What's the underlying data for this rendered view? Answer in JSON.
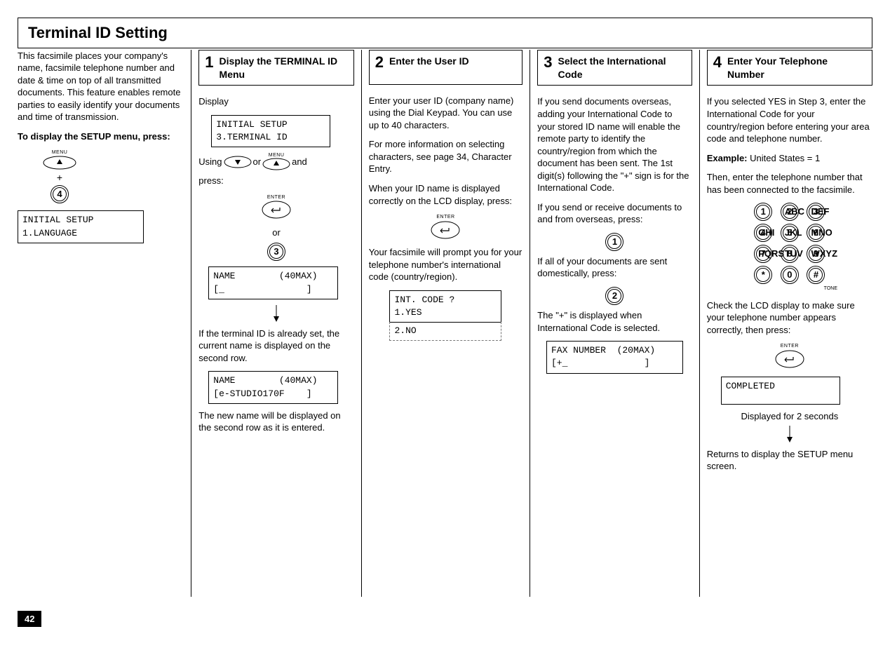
{
  "page_number": "42",
  "title": "Terminal ID Setting",
  "intro": {
    "p1": "This facsimile places your company's name, facsimile telephone number and date & time on top of all transmitted documents. This feature enables remote parties to easily identify your documents and time of transmission.",
    "p2": "To display the SETUP menu, press:",
    "menu_label": "MENU",
    "plus": "+",
    "key4": "4",
    "lcd": "INITIAL SETUP\n1.LANGUAGE"
  },
  "step1": {
    "num": "1",
    "title": "Display the TERMINAL ID Menu",
    "display_label": "Display",
    "lcd1": "INITIAL SETUP\n3.TERMINAL ID",
    "using": "Using",
    "or": "or",
    "and": "and",
    "press": "press:",
    "menu_label": "MENU",
    "enter_label": "ENTER",
    "or2": "or",
    "key3": "3",
    "lcd2_l1": "NAME        (40MAX)",
    "lcd2_l2": "[_               ]",
    "note1": "If  the terminal ID is already set, the current name is displayed on the second row.",
    "lcd3_l1": "NAME        (40MAX)",
    "lcd3_l2": "[e-STUDIO170F    ]",
    "note2": "The new name will be displayed on the second row as it is entered."
  },
  "step2": {
    "num": "2",
    "title": "Enter the User ID",
    "p1": "Enter your user ID (company name) using the Dial Keypad. You can use up to 40 characters.",
    "p2": "For more information on selecting characters, see page 34, Character Entry.",
    "p3": "When your ID name is displayed correctly on the LCD display, press:",
    "enter_label": "ENTER",
    "p4": "Your facsimile will prompt you for your telephone number's international code (country/region).",
    "lcd_l1": "INT. CODE ?",
    "lcd_l2": "1.YES",
    "lcd_ext": " 2.NO"
  },
  "step3": {
    "num": "3",
    "title": "Select the International Code",
    "p1": "If you send documents overseas, adding your International Code to your stored ID name will enable the remote party to identify the country/region from which the document has been sent. The 1st digit(s) following the \"+\" sign is for the International Code.",
    "p2": "If you send or receive documents to and from overseas, press:",
    "key1": "1",
    "p3": "If all of your documents are sent domestically, press:",
    "key2": "2",
    "p4": "The \"+\" is displayed when International Code is selected.",
    "lcd_l1": "FAX NUMBER  (20MAX)",
    "lcd_l2": "[+_              ]"
  },
  "step4": {
    "num": "4",
    "title": "Enter Your Telephone Number",
    "p1": "If you selected YES in Step 3, enter the International Code for your country/region before entering your area code and telephone number.",
    "ex_label": "Example:",
    "ex_val": " United States = 1",
    "p2": "Then, enter the telephone number that has been connected to the facsimile.",
    "keys": {
      "k1": "1",
      "k2": "2",
      "k3": "3",
      "k4": "4",
      "k5": "5",
      "k6": "6",
      "k7": "7",
      "k8": "8",
      "k9": "9",
      "ks": "*",
      "k0": "0",
      "kh": "#"
    },
    "sups": {
      "s2": "ABC",
      "s3": "DEF",
      "s4": "GHI",
      "s5": "JKL",
      "s6": "MNO",
      "s7": "PQRS",
      "s8": "TUV",
      "s9": "WXYZ"
    },
    "tone": "TONE",
    "p3": "Check the LCD display to make sure your telephone number appears correctly, then press:",
    "enter_label": "ENTER",
    "lcd": "COMPLETED",
    "disp2s": "Displayed for 2 seconds",
    "ret": "Returns to display the SETUP menu screen."
  }
}
